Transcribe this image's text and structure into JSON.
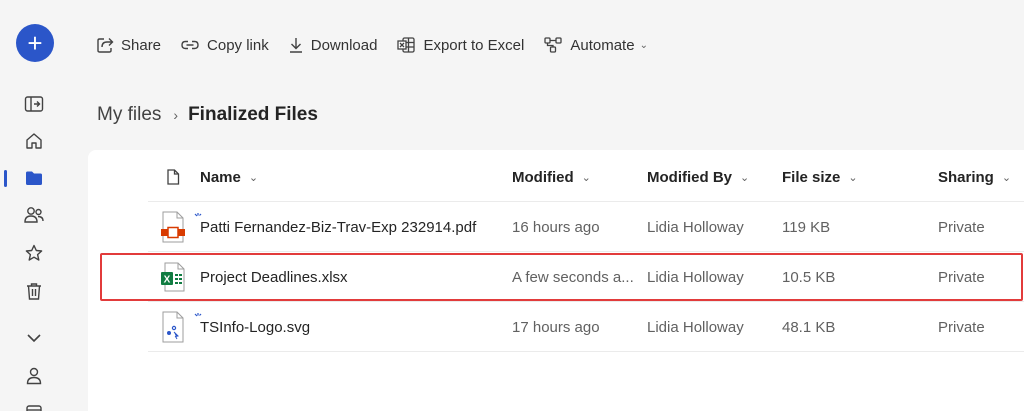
{
  "rail": {
    "create_label": "+",
    "icons": [
      "open-pane-icon",
      "home-icon",
      "my-files-folder-icon",
      "shared-people-icon",
      "favorites-star-icon",
      "recycle-bin-icon",
      "chevron-down-icon",
      "person-icon",
      "calendar-icon"
    ]
  },
  "toolbar": {
    "share_label": "Share",
    "copy_link_label": "Copy link",
    "download_label": "Download",
    "export_label": "Export to Excel",
    "automate_label": "Automate"
  },
  "breadcrumb": {
    "root": "My files",
    "separator": "›",
    "current": "Finalized Files"
  },
  "table": {
    "headers": {
      "name": "Name",
      "modified": "Modified",
      "modified_by": "Modified By",
      "file_size": "File size",
      "sharing": "Sharing"
    },
    "rows": [
      {
        "name": "Patti Fernandez-Biz-Trav-Exp 232914.pdf",
        "modified": "16 hours ago",
        "modified_by": "Lidia Holloway",
        "file_size": "119 KB",
        "sharing": "Private",
        "icon": "pdf-file-icon",
        "is_new": true
      },
      {
        "name": "Project Deadlines.xlsx",
        "modified": "A few seconds a...",
        "modified_by": "Lidia Holloway",
        "file_size": "10.5 KB",
        "sharing": "Private",
        "icon": "excel-file-icon",
        "is_new": false
      },
      {
        "name": "TSInfo-Logo.svg",
        "modified": "17 hours ago",
        "modified_by": "Lidia Holloway",
        "file_size": "48.1 KB",
        "sharing": "Private",
        "icon": "svg-file-icon",
        "is_new": true
      }
    ]
  },
  "colors": {
    "accent": "#2b56c9",
    "highlight_border": "#e23b3b",
    "excel_green": "#107c41",
    "pdf_red": "#d83b01"
  }
}
